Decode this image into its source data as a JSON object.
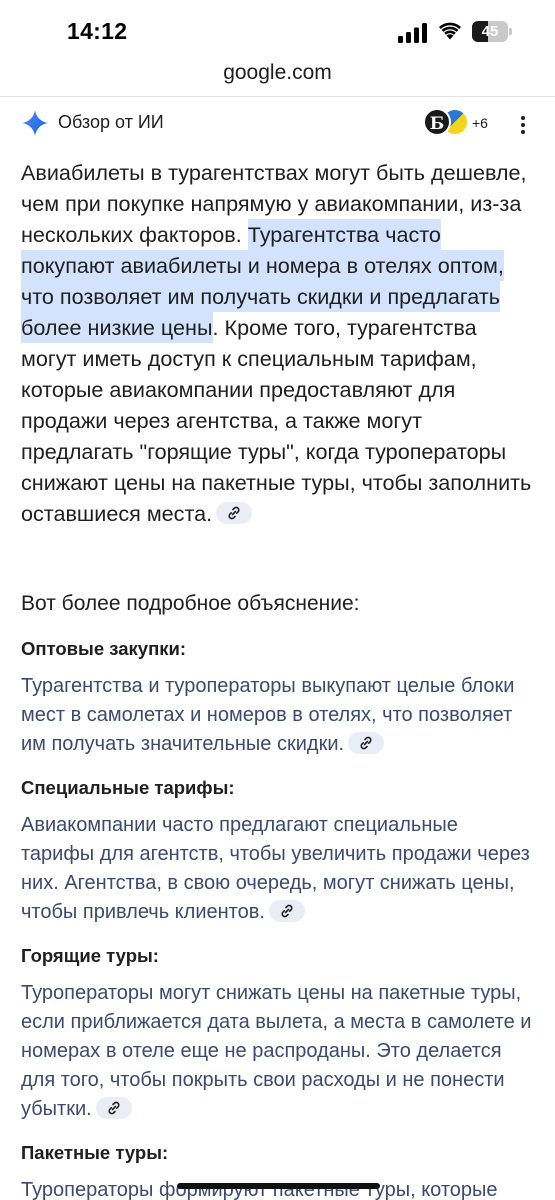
{
  "status_bar": {
    "time": "14:12",
    "battery_level": "45",
    "battery_fraction": 0.45,
    "icons": [
      "signal-icon",
      "wifi-icon",
      "battery-icon"
    ]
  },
  "browser": {
    "url": "google.com"
  },
  "ai_overview": {
    "title": "Обзор от ИИ",
    "source_avatar_letter": "Б",
    "extra_sources": "+6",
    "accent_color": "#1a73e8",
    "highlight_color": "#d3e3fd",
    "intro_part1": "Авиабилеты в турагентствах могут быть дешевле, чем при покупке напрямую у авиакомпании, из-за нескольких факторов. ",
    "intro_highlight": "Турагентства часто покупают авиабилеты и номера в отелях оптом, что позволяет им получать скидки и предлагать более низкие цены",
    "intro_part2": ". Кроме того, турагентства могут иметь доступ к специальным тарифам, которые авиакомпании предоставляют для продажи через агентства, а также могут предлагать \"горящие туры\", когда туроператоры снижают цены на пакетные туры, чтобы заполнить оставшиеся места.",
    "details_heading": "Вот более подробное объяснение:",
    "sections": [
      {
        "title": "Оптовые закупки:",
        "text": "Турагентства и туроператоры выкупают целые блоки мест в самолетах и номеров в отелях, что позволяет им получать значительные скидки."
      },
      {
        "title": "Специальные тарифы:",
        "text": "Авиакомпании часто предлагают специальные тарифы для агентств, чтобы увеличить продажи через них. Агентства, в свою очередь, могут снижать цены, чтобы привлечь клиентов."
      },
      {
        "title": "Горящие туры:",
        "text": "Туроператоры могут снижать цены на пакетные туры, если приближается дата вылета, а места в самолете и номерах в отеле еще не распроданы. Это делается для того, чтобы покрыть свои расходы и не понести убытки."
      },
      {
        "title": "Пакетные туры:",
        "text": "Туроператоры формируют пакетные туры, которые"
      }
    ]
  }
}
